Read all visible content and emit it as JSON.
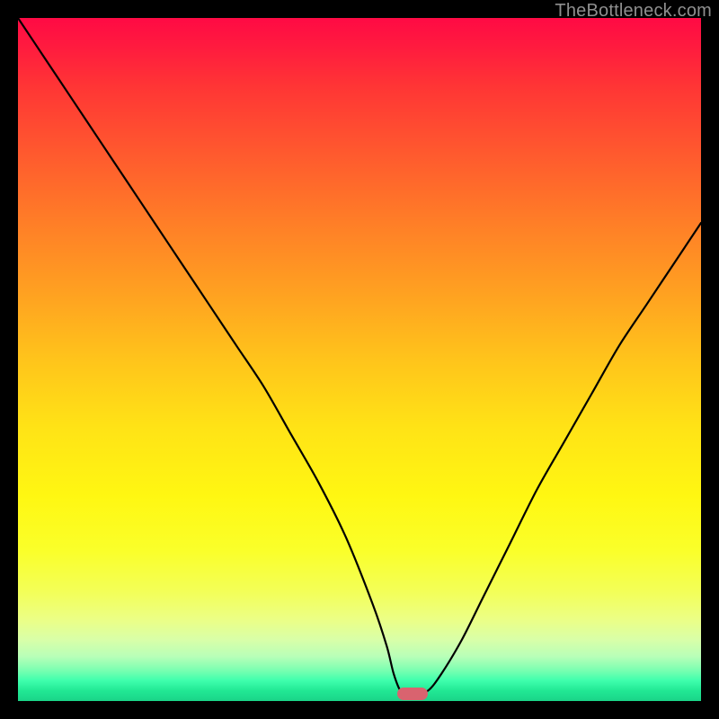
{
  "watermark": "TheBottleneck.com",
  "chart_data": {
    "type": "line",
    "title": "",
    "xlabel": "",
    "ylabel": "",
    "xlim": [
      0,
      100
    ],
    "ylim": [
      0,
      100
    ],
    "grid": false,
    "legend": false,
    "series": [
      {
        "name": "bottleneck-curve",
        "x": [
          0,
          4,
          8,
          12,
          16,
          20,
          24,
          28,
          32,
          36,
          40,
          44,
          48,
          52,
          54,
          55,
          56,
          57,
          58,
          60,
          62,
          65,
          68,
          72,
          76,
          80,
          84,
          88,
          92,
          96,
          100
        ],
        "y": [
          100,
          94,
          88,
          82,
          76,
          70,
          64,
          58,
          52,
          46,
          39,
          32,
          24,
          14,
          8,
          4,
          1.5,
          1.2,
          1.2,
          1.5,
          4,
          9,
          15,
          23,
          31,
          38,
          45,
          52,
          58,
          64,
          70
        ]
      }
    ],
    "marker": {
      "x_start": 55.5,
      "x_end": 60,
      "y": 1
    },
    "gradient_stops": [
      {
        "pos": 0,
        "color": "#ff0a44"
      },
      {
        "pos": 0.5,
        "color": "#ffc41b"
      },
      {
        "pos": 0.78,
        "color": "#faff2a"
      },
      {
        "pos": 1.0,
        "color": "#1ad488"
      }
    ]
  }
}
